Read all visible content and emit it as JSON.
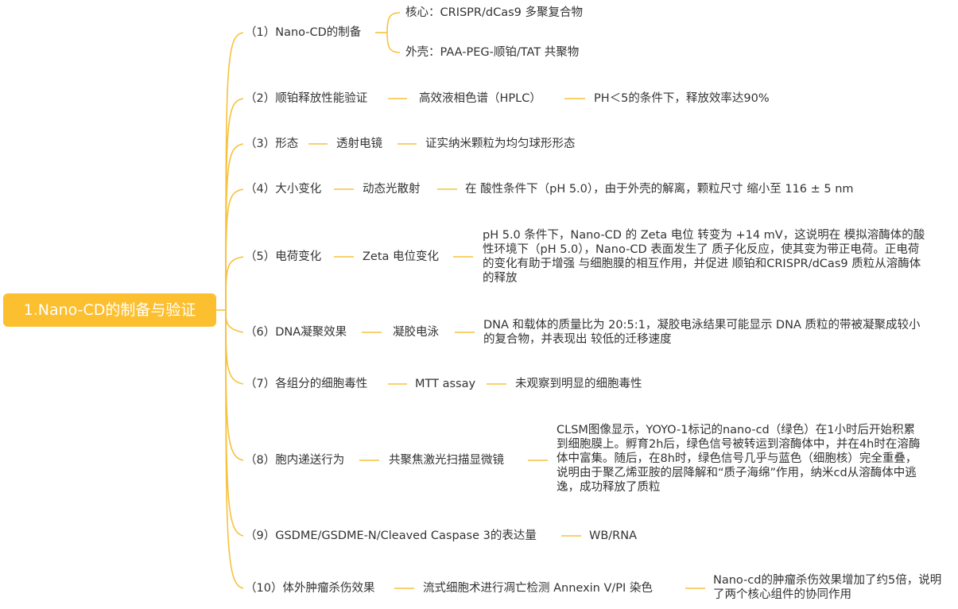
{
  "root": "1.Nano-CD的制备与验证",
  "colors": {
    "accent": "#fcbf2f",
    "line": "#f7c23c",
    "text": "#333333"
  },
  "b1": {
    "label": "（1）Nano-CD的制备",
    "core": "核心：CRISPR/dCas9 多聚复合物",
    "shell": "外壳：PAA-PEG-顺铂/TAT 共聚物"
  },
  "b2": {
    "label": "（2）顺铂释放性能验证",
    "method": "高效液相色谱（HPLC）",
    "result": "PH＜5的条件下，释放效率达90%"
  },
  "b3": {
    "label": "（3）形态",
    "method": "透射电镜",
    "result": "证实纳米颗粒为均匀球形形态"
  },
  "b4": {
    "label": "（4）大小变化",
    "method": "动态光散射",
    "result": "在 酸性条件下（pH 5.0），由于外壳的解离，颗粒尺寸 缩小至 116 ± 5 nm"
  },
  "b5": {
    "label": "（5）电荷变化",
    "method": "Zeta 电位变化",
    "result": "pH 5.0 条件下，Nano-CD 的 Zeta 电位 转变为 +14 mV，这说明在 模拟溶酶体的酸性环境下（pH 5.0），Nano-CD 表面发生了 质子化反应，使其变为带正电荷。正电荷的变化有助于增强 与细胞膜的相互作用，并促进 顺铂和CRISPR/dCas9 质粒从溶酶体的释放"
  },
  "b6": {
    "label": "（6）DNA凝聚效果",
    "method": "凝胶电泳",
    "result": "DNA 和载体的质量比为 20:5:1，凝胶电泳结果可能显示 DNA 质粒的带被凝聚成较小的复合物，并表现出 较低的迁移速度"
  },
  "b7": {
    "label": "（7）各组分的细胞毒性",
    "method": "MTT assay",
    "result": "未观察到明显的细胞毒性"
  },
  "b8": {
    "label": "（8）胞内递送行为",
    "method": "共聚焦激光扫描显微镜",
    "result": "CLSM图像显示，YOYO-1标记的nano-cd（绿色）在1小时后开始积累到细胞膜上。孵育2h后，绿色信号被转运到溶酶体中，并在4h时在溶酶体中富集。随后，在8h时，绿色信号几乎与蓝色（细胞核）完全重叠，说明由于聚乙烯亚胺的层降解和“质子海绵”作用，纳米cd从溶酶体中逃逸，成功释放了质粒"
  },
  "b9": {
    "label": "（9）GSDME/GSDME-N/Cleaved Caspase 3的表达量",
    "method": "WB/RNA"
  },
  "b10": {
    "label": "（10）体外肿瘤杀伤效果",
    "method": "流式细胞术进行凋亡检测 Annexin V/PI 染色",
    "result": "Nano-cd的肿瘤杀伤效果增加了约5倍，说明了两个核心组件的协同作用"
  }
}
